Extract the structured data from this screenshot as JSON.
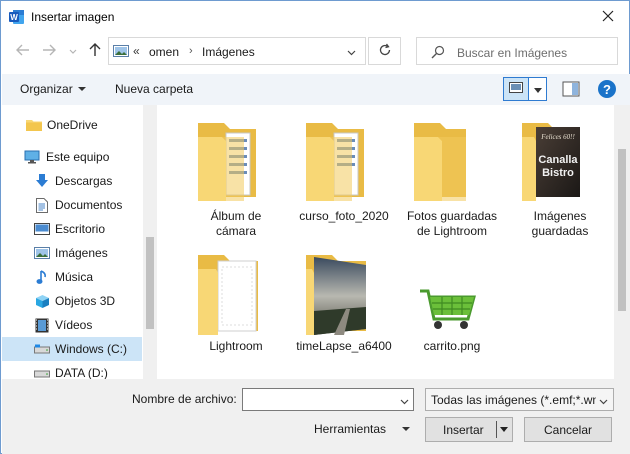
{
  "window": {
    "title": "Insertar imagen",
    "app_icon": "word-icon"
  },
  "address": {
    "overflow": "«",
    "segments": [
      "omen",
      "Imágenes"
    ],
    "separator": "›",
    "search_placeholder": "Buscar en Imágenes"
  },
  "toolbar": {
    "organize_label": "Organizar",
    "new_folder_label": "Nueva carpeta"
  },
  "sidebar": {
    "items": [
      {
        "label": "OneDrive",
        "icon": "folder-icon"
      },
      {
        "label": "Este equipo",
        "icon": "computer-icon"
      },
      {
        "label": "Descargas",
        "icon": "download-icon"
      },
      {
        "label": "Documentos",
        "icon": "document-icon"
      },
      {
        "label": "Escritorio",
        "icon": "desktop-icon"
      },
      {
        "label": "Imágenes",
        "icon": "pictures-icon"
      },
      {
        "label": "Música",
        "icon": "music-icon"
      },
      {
        "label": "Objetos 3D",
        "icon": "cube-icon"
      },
      {
        "label": "Vídeos",
        "icon": "video-icon"
      },
      {
        "label": "Windows (C:)",
        "icon": "drive-icon",
        "selected": true
      },
      {
        "label": "DATA (D:)",
        "icon": "drive-icon"
      }
    ]
  },
  "files": [
    {
      "label_line1": "Álbum de",
      "label_line2": "cámara",
      "type": "folder"
    },
    {
      "label_line1": "curso_foto_2020",
      "label_line2": "",
      "type": "folder"
    },
    {
      "label_line1": "Fotos guardadas",
      "label_line2": "de Lightroom",
      "type": "folder"
    },
    {
      "label_line1": "Imágenes",
      "label_line2": "guardadas",
      "type": "folder",
      "preview_text_1": "Felices 60!!",
      "preview_text_2": "Canalla",
      "preview_text_3": "Bistro"
    },
    {
      "label_line1": "Lightroom",
      "label_line2": "",
      "type": "folder"
    },
    {
      "label_line1": "timeLapse_a6400",
      "label_line2": "",
      "type": "folder"
    },
    {
      "label_line1": "carrito.png",
      "label_line2": "",
      "type": "image"
    }
  ],
  "footer": {
    "filename_label": "Nombre de archivo:",
    "filename_value": "",
    "filter_value": "Todas las imágenes (*.emf;*.wmf",
    "tools_label": "Herramientas",
    "insert_label": "Insertar",
    "cancel_label": "Cancelar"
  },
  "colors": {
    "accent": "#1a73c9",
    "folder": "#f8d775",
    "selected": "#cce4f7"
  }
}
